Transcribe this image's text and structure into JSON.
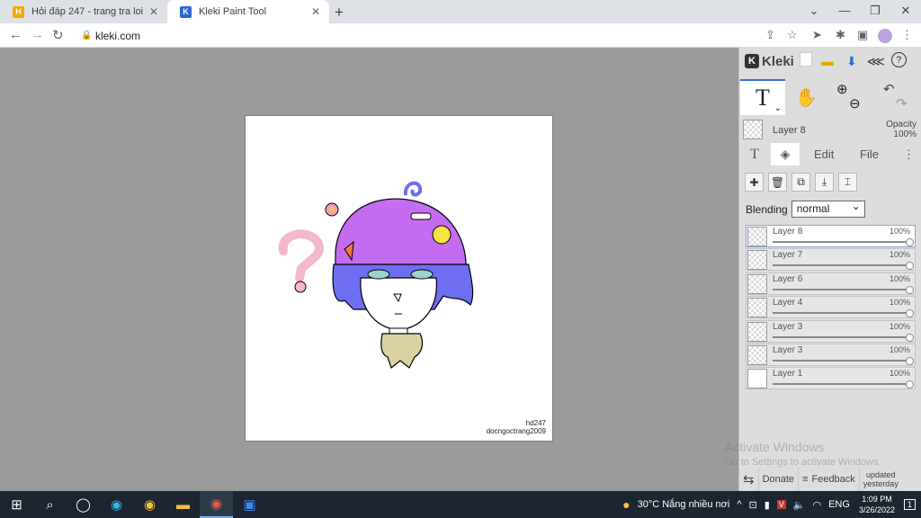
{
  "browser": {
    "tabs": [
      {
        "title": "Hỏi đáp 247 - trang tra loi",
        "favicon": "H",
        "favicon_color": "#f2a900",
        "active": false
      },
      {
        "title": "Kleki Paint Tool",
        "favicon": "K",
        "favicon_color": "#2b66d9",
        "active": true
      }
    ],
    "new_tab": "+",
    "url": "kleki.com",
    "window_controls": [
      "⌄",
      "—",
      "❐",
      "✕"
    ]
  },
  "canvas": {
    "signature_line1": "hd247",
    "signature_line2": "docngoctrang2009"
  },
  "app": {
    "name": "Kleki",
    "current_layer": {
      "name": "Layer 8",
      "opacity_label": "Opacity",
      "opacity_value": "100%"
    },
    "tabs": {
      "text": "T",
      "edit": "Edit",
      "file": "File"
    },
    "blending": {
      "label": "Blending",
      "value": "normal"
    },
    "layers": [
      {
        "name": "Layer 8",
        "opacity": "100%",
        "selected": true
      },
      {
        "name": "Layer 7",
        "opacity": "100%",
        "selected": false
      },
      {
        "name": "Layer 6",
        "opacity": "100%",
        "selected": false
      },
      {
        "name": "Layer 4",
        "opacity": "100%",
        "selected": false
      },
      {
        "name": "Layer 3",
        "opacity": "100%",
        "selected": false
      },
      {
        "name": "Layer 3",
        "opacity": "100%",
        "selected": false
      },
      {
        "name": "Layer 1",
        "opacity": "100%",
        "selected": false
      }
    ],
    "watermark_line1": "Activate Windows",
    "watermark_line2": "Go to Settings to activate Windows.",
    "footer": {
      "donate": "Donate",
      "feedback": "Feedback",
      "updated_line1": "updated",
      "updated_line2": "yesterday"
    }
  },
  "taskbar": {
    "weather": "30°C  Nắng nhiều nơi",
    "language": "ENG",
    "time": "1:09 PM",
    "date": "3/26/2022",
    "notification_count": "1"
  }
}
